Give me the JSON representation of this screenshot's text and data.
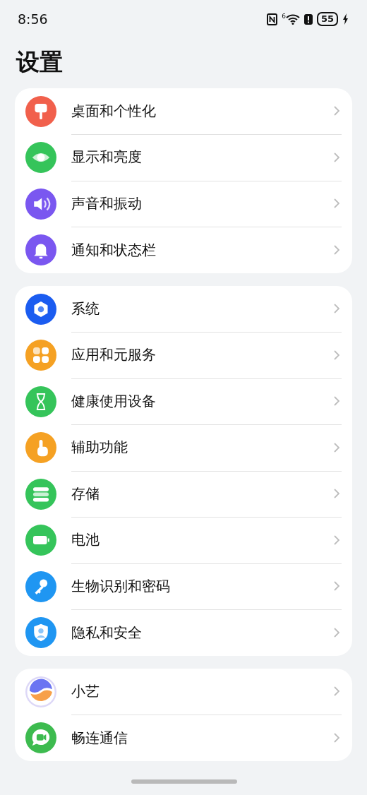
{
  "status_bar": {
    "time": "8:56",
    "wifi_label": "6",
    "battery": "55"
  },
  "title": "设置",
  "groups": [
    {
      "items": [
        {
          "label": "桌面和个性化",
          "kind": "palette",
          "color": "#f1604c"
        },
        {
          "label": "显示和亮度",
          "kind": "eye",
          "color": "#35c45a"
        },
        {
          "label": "声音和振动",
          "kind": "speaker",
          "color": "#7a57f0"
        },
        {
          "label": "通知和状态栏",
          "kind": "bell",
          "color": "#7a57f0"
        }
      ]
    },
    {
      "items": [
        {
          "label": "系统",
          "kind": "gear",
          "color": "#1b5cf0"
        },
        {
          "label": "应用和元服务",
          "kind": "grid",
          "color": "#f5a123"
        },
        {
          "label": "健康使用设备",
          "kind": "hourglass",
          "color": "#35c45a"
        },
        {
          "label": "辅助功能",
          "kind": "hand",
          "color": "#f5a123"
        },
        {
          "label": "存储",
          "kind": "storage",
          "color": "#35c45a"
        },
        {
          "label": "电池",
          "kind": "battery",
          "color": "#35c45a"
        },
        {
          "label": "生物识别和密码",
          "kind": "key",
          "color": "#1f96f2"
        },
        {
          "label": "隐私和安全",
          "kind": "shield",
          "color": "#1f96f2"
        }
      ]
    },
    {
      "items": [
        {
          "label": "小艺",
          "kind": "orb",
          "color": "#ddd8f7"
        },
        {
          "label": "畅连通信",
          "kind": "chat",
          "color": "#3dbb4f"
        }
      ]
    }
  ]
}
